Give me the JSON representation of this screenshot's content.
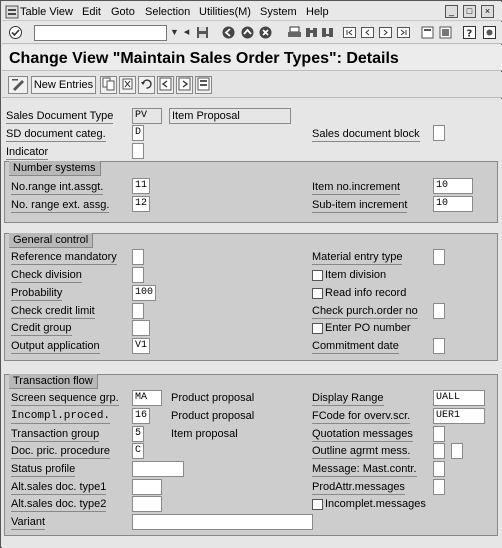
{
  "menu": {
    "items": [
      "Table View",
      "Edit",
      "Goto",
      "Selection",
      "Utilities(M)",
      "System",
      "Help"
    ]
  },
  "title": "Change View \"Maintain Sales Order Types\": Details",
  "app_toolbar": {
    "new_entries_label": "New Entries"
  },
  "header_fields": {
    "sales_doc_type_label": "Sales Document Type",
    "sales_doc_type_value": "PV",
    "sales_doc_type_desc": "Item Proposal",
    "sd_doc_categ_label": "SD document categ.",
    "sd_doc_categ_value": "D",
    "sales_doc_block_label": "Sales document block",
    "indicator_label": "Indicator"
  },
  "number_systems": {
    "title": "Number systems",
    "no_range_int_label": "No.range int.assgt.",
    "no_range_int_value": "11",
    "no_range_ext_label": "No. range ext. assg.",
    "no_range_ext_value": "12",
    "item_no_incr_label": "Item no.increment",
    "item_no_incr_value": "10",
    "sub_item_incr_label": "Sub-item increment",
    "sub_item_incr_value": "10"
  },
  "general_control": {
    "title": "General control",
    "ref_mandatory_label": "Reference mandatory",
    "check_division_label": "Check division",
    "probability_label": "Probability",
    "probability_value": "100",
    "check_credit_limit_label": "Check credit limit",
    "credit_group_label": "Credit group",
    "output_application_label": "Output application",
    "output_application_value": "V1",
    "material_entry_type_label": "Material entry type",
    "item_division_label": "Item division",
    "read_info_record_label": "Read info record",
    "check_purch_order_label": "Check purch.order no",
    "enter_po_number_label": "Enter PO number",
    "commitment_date_label": "Commitment  date"
  },
  "transaction_flow": {
    "title": "Transaction flow",
    "screen_seq_label": "Screen sequence grp.",
    "screen_seq_value": "MA",
    "screen_seq_desc": "Product proposal",
    "incompl_proced_label": "Incompl.proced.",
    "incompl_proced_value": "16",
    "incompl_proced_desc": "Product proposal",
    "transaction_group_label": "Transaction group",
    "transaction_group_value": "5",
    "transaction_group_desc": "Item proposal",
    "doc_pric_proc_label": "Doc. pric. procedure",
    "doc_pric_proc_value": "C",
    "status_profile_label": "Status profile",
    "alt_type1_label": "Alt.sales doc. type1",
    "alt_type2_label": "Alt.sales doc. type2",
    "variant_label": "Variant",
    "display_range_label": "Display Range",
    "display_range_value": "UALL",
    "fcode_label": "FCode for overv.scr.",
    "fcode_value": "UER1",
    "quotation_msgs_label": "Quotation messages",
    "outline_agrmt_label": "Outline agrmt mess.",
    "message_mast_label": "Message: Mast.contr.",
    "prodattr_label": "ProdAttr.messages",
    "incomplet_msgs_label": "Incomplet.messages"
  }
}
